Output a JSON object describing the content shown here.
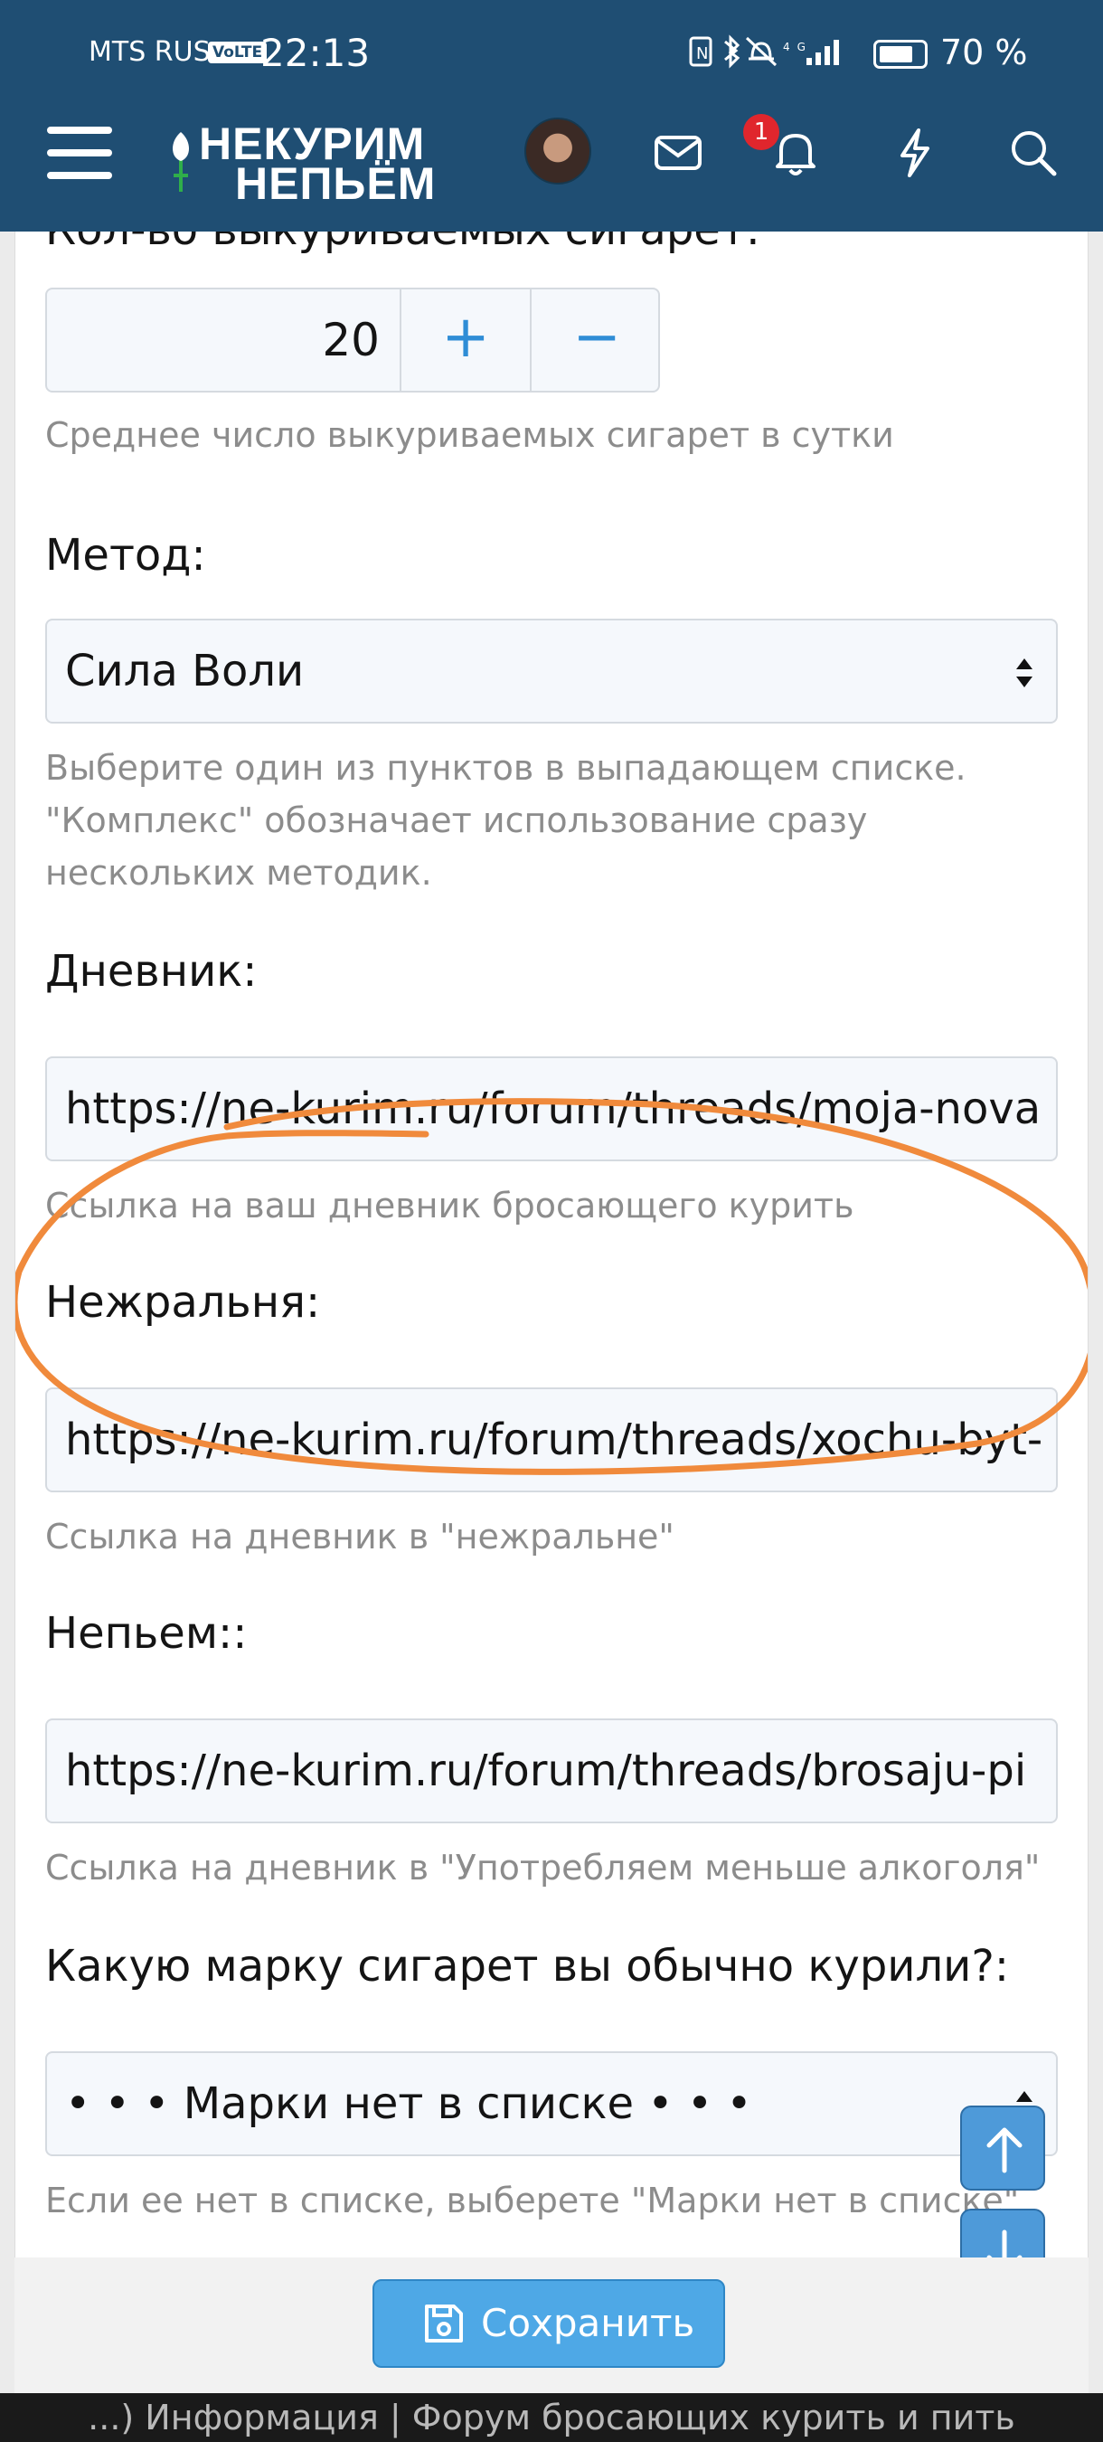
{
  "status_bar": {
    "carrier": "MTS RUS",
    "volte": "VoLTE",
    "time": "22:13",
    "network": "4G",
    "battery": "70 %"
  },
  "header": {
    "logo_line1": "НЕКУРИМ",
    "logo_line2": "НЕПЬЁМ",
    "notification_count": "1",
    "brand_color": "#1f4e73"
  },
  "form": {
    "cigarettes_label": "Кол-во выкуриваемых сигарет:",
    "cigarettes_value": "20",
    "cigarettes_hint": "Среднее число выкуриваемых сигарет в сутки",
    "method_label": "Метод:",
    "method_value": "Сила Воли",
    "method_hint_1": "Выберите один из пунктов в выпадающем списке.",
    "method_hint_2": "\"Комплекс\" обозначает использование сразу",
    "method_hint_3": "нескольких методик.",
    "diary_label": "Дневник:",
    "diary_value": "https://ne-kurim.ru/forum/threads/moja-nova",
    "diary_hint": "Ссылка на ваш дневник бросающего курить",
    "nezhralnya_label": "Нежральня:",
    "nezhralnya_value": "https://ne-kurim.ru/forum/threads/xochu-byt-",
    "nezhralnya_hint": "Ссылка на дневник в \"нежральне\"",
    "nepyem_label": "Непьем::",
    "nepyem_value": "https://ne-kurim.ru/forum/threads/brosaju-pi",
    "nepyem_hint": "Ссылка на дневник в \"Употребляем меньше алкоголя\"",
    "brand_label": "Какую марку сигарет вы обычно курили?:",
    "brand_value": "• • •  Марки нет в списке  • • •",
    "brand_hint": "Если ее нет в списке, выберете \"Марки нет в списке\""
  },
  "save_label": "Сохранить",
  "footer_title": "...) Информация | Форум бросающих курить и пить",
  "annotation_color": "#f08a3c"
}
